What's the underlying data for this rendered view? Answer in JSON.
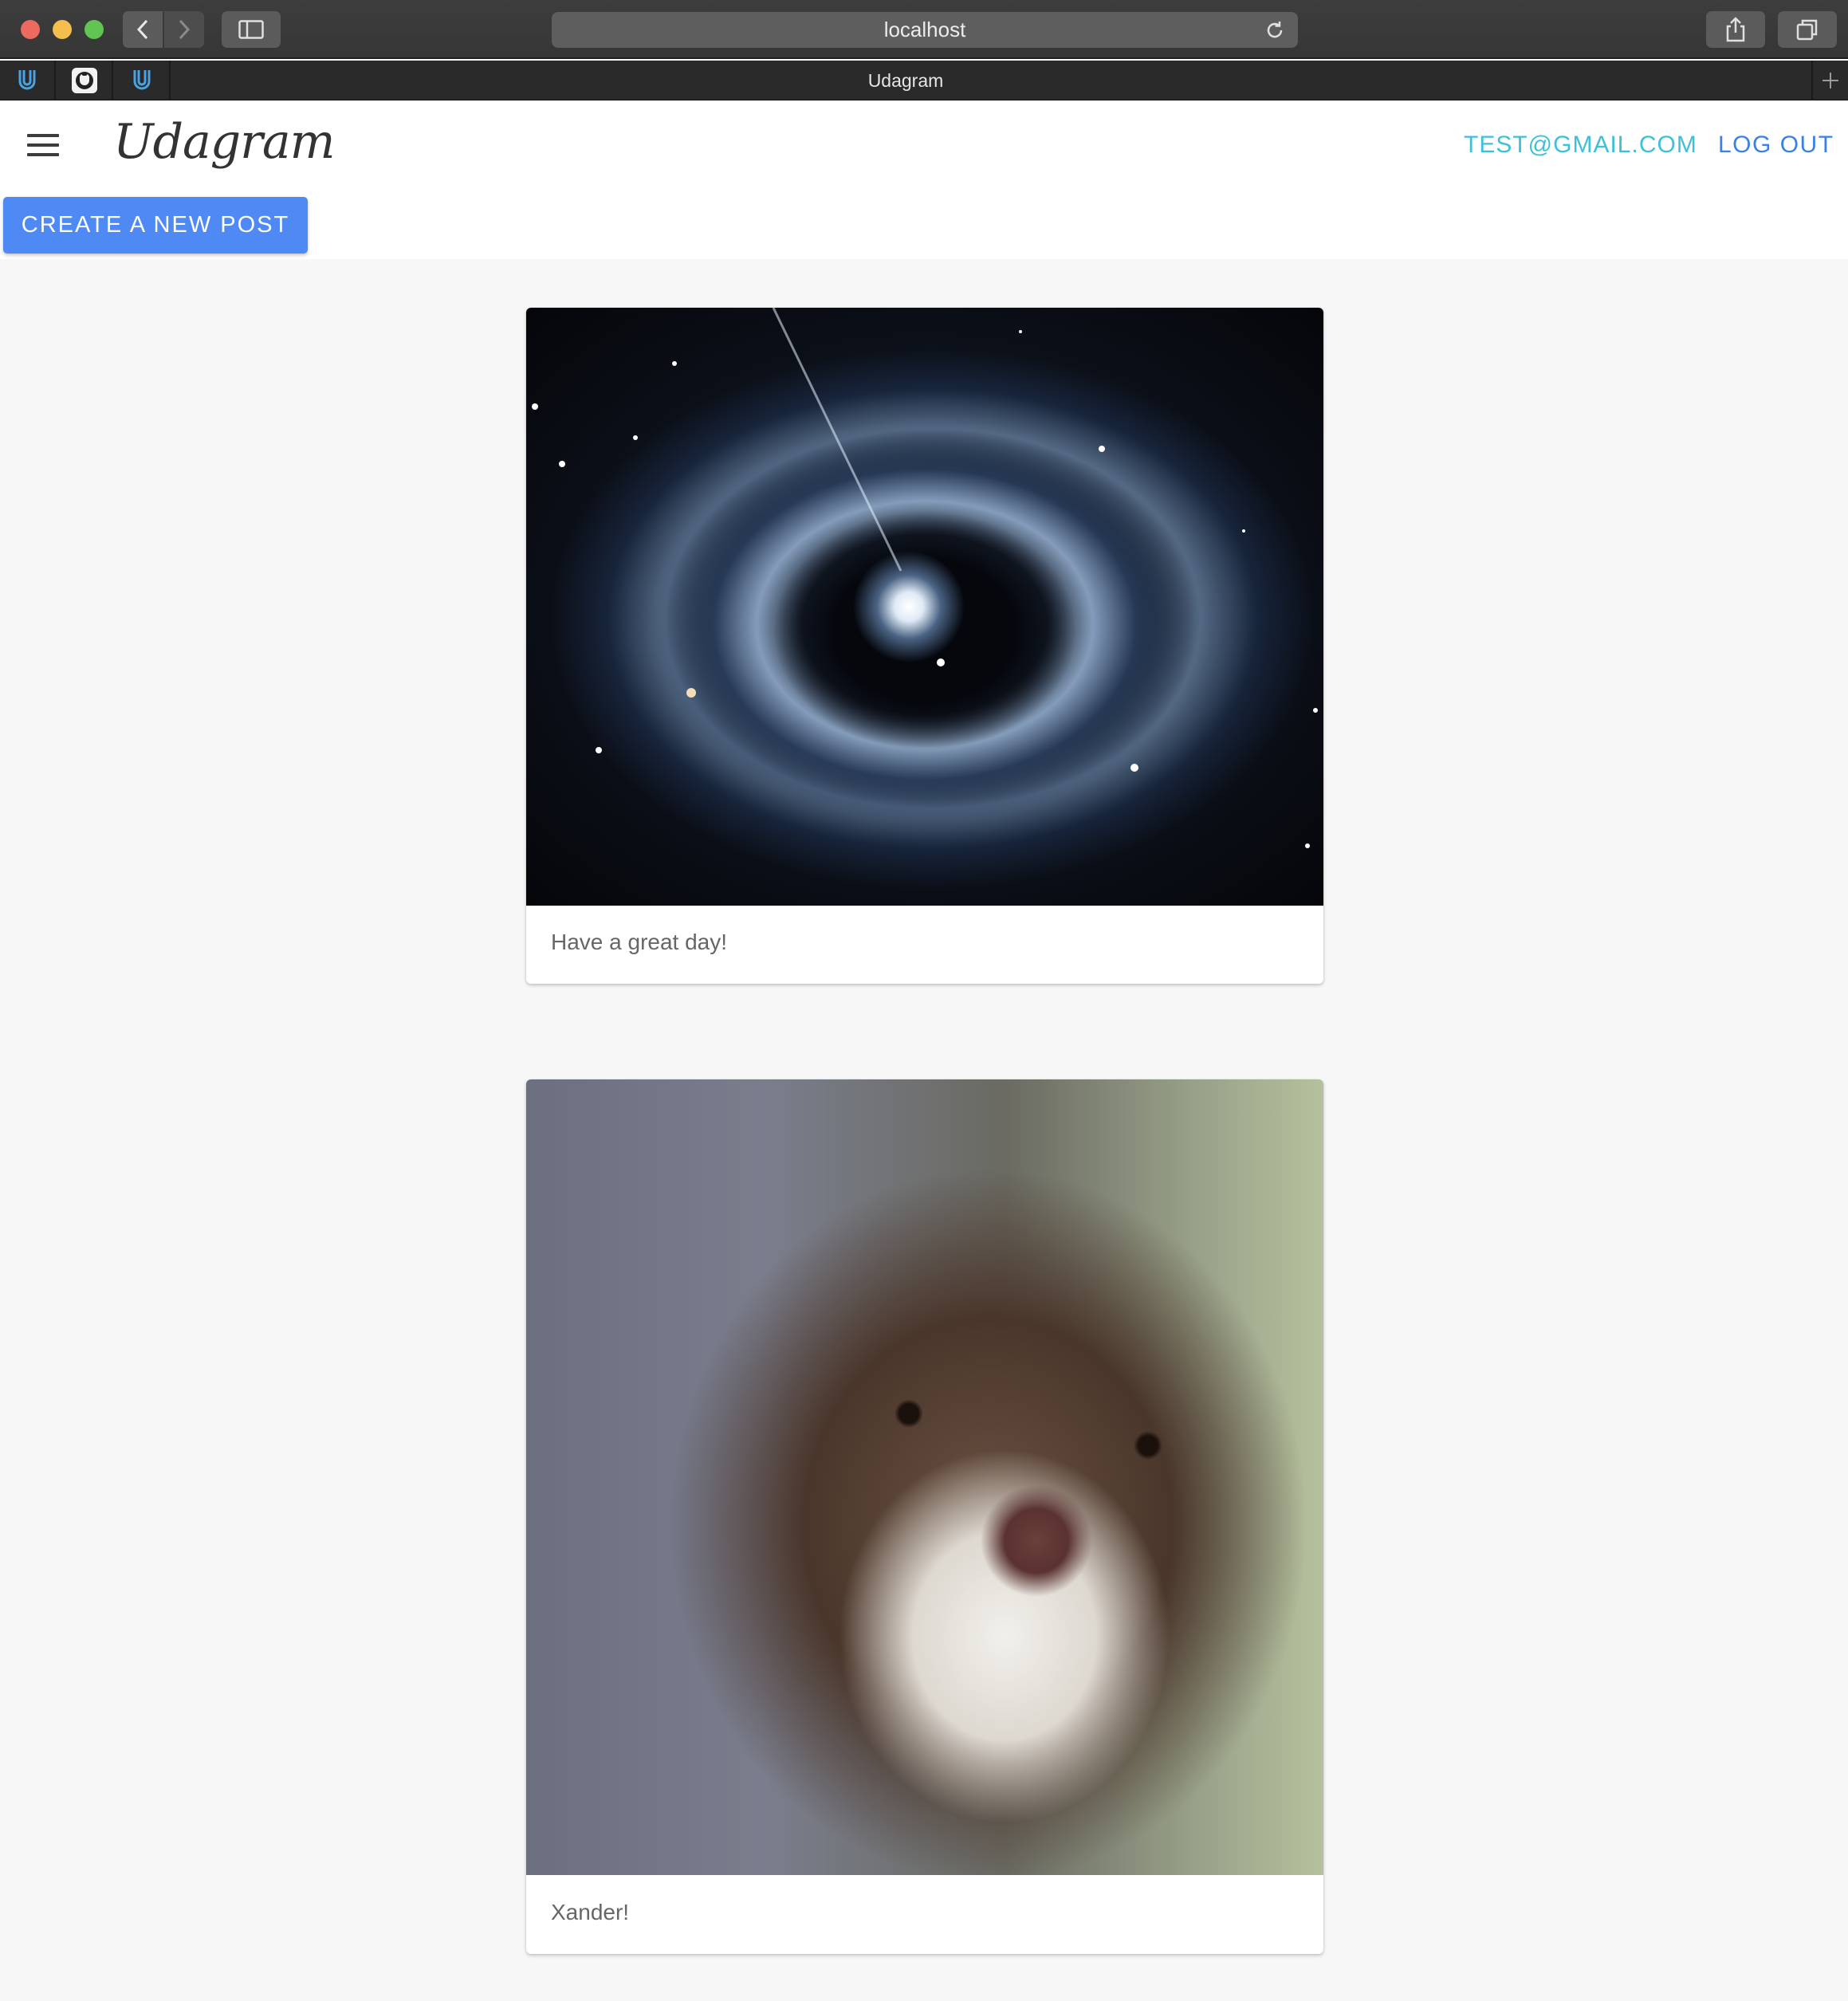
{
  "browser": {
    "url": "localhost",
    "tab_title": "Udagram",
    "pinned_tabs": [
      "udacity-icon",
      "github-icon",
      "udacity-icon"
    ]
  },
  "header": {
    "brand": "Udagram",
    "user_email": "TEST@GMAIL.COM",
    "logout_label": "LOG OUT"
  },
  "actions": {
    "create_post_label": "CREATE A NEW POST"
  },
  "feed": {
    "posts": [
      {
        "caption": "Have a great day!",
        "image": "galaxy-image"
      },
      {
        "caption": "Xander!",
        "image": "dog-image"
      }
    ]
  },
  "colors": {
    "accent": "#4f8af4",
    "email": "#3ec0d8",
    "logout": "#3b80e6",
    "background": "#f7f7f7"
  }
}
